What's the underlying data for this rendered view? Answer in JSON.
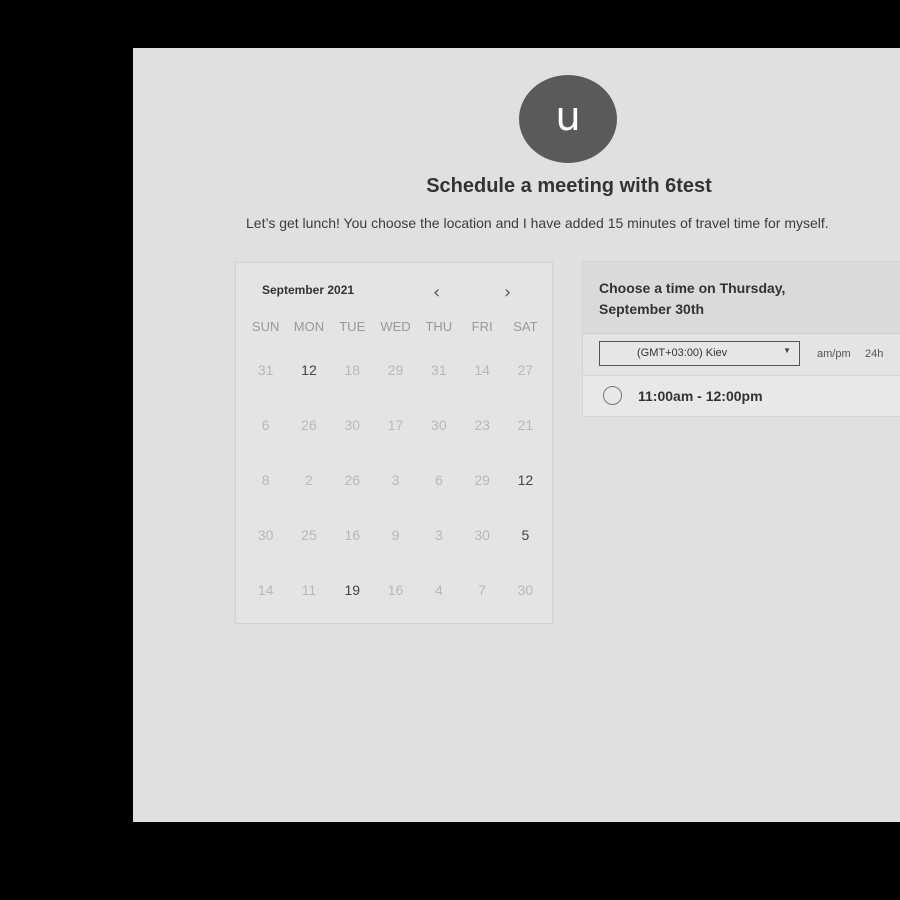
{
  "avatar": {
    "initial": "u"
  },
  "title": "Schedule a meeting with 6test",
  "description": "Let’s get lunch! You choose the location and I have added 15 minutes of travel time for myself.",
  "calendar": {
    "month_label": "September 2021",
    "prev_icon": "‹",
    "next_icon": "›",
    "weekdays": [
      "SUN",
      "MON",
      "TUE",
      "WED",
      "THU",
      "FRI",
      "SAT"
    ],
    "weeks": [
      [
        {
          "day": "31"
        },
        {
          "day": "12",
          "available": true
        },
        {
          "day": "18"
        },
        {
          "day": "29"
        },
        {
          "day": "31"
        },
        {
          "day": "14"
        },
        {
          "day": "27"
        }
      ],
      [
        {
          "day": "6"
        },
        {
          "day": "26"
        },
        {
          "day": "30"
        },
        {
          "day": "17"
        },
        {
          "day": "30"
        },
        {
          "day": "23"
        },
        {
          "day": "21"
        }
      ],
      [
        {
          "day": "8"
        },
        {
          "day": "2"
        },
        {
          "day": "26"
        },
        {
          "day": "3"
        },
        {
          "day": "6"
        },
        {
          "day": "29"
        },
        {
          "day": "12",
          "available": true
        }
      ],
      [
        {
          "day": "30"
        },
        {
          "day": "25"
        },
        {
          "day": "16"
        },
        {
          "day": "9"
        },
        {
          "day": "3"
        },
        {
          "day": "30"
        },
        {
          "day": "5",
          "available": true
        }
      ],
      [
        {
          "day": "14"
        },
        {
          "day": "11"
        },
        {
          "day": "19",
          "available": true
        },
        {
          "day": "16"
        },
        {
          "day": "4"
        },
        {
          "day": "7"
        },
        {
          "day": "30"
        }
      ]
    ]
  },
  "time_panel": {
    "heading": "Choose a time on Thursday, September 30th",
    "timezone": "(GMT+03:00) Kiev",
    "format_ampm": "am/pm",
    "format_24h": "24h",
    "slots": [
      {
        "label": "11:00am - 12:00pm"
      }
    ]
  }
}
